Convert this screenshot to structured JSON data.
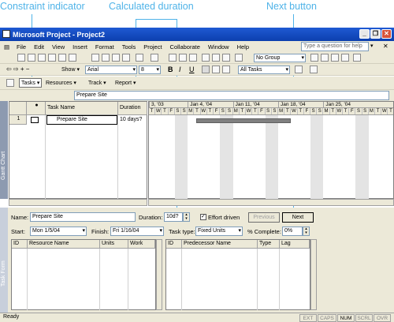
{
  "callouts": {
    "constraint": "Constraint indicator",
    "duration": "Calculated duration",
    "next": "Next button"
  },
  "window": {
    "title": "Microsoft Project - Project2"
  },
  "menu": [
    "File",
    "Edit",
    "View",
    "Insert",
    "Format",
    "Tools",
    "Project",
    "Collaborate",
    "Window",
    "Help"
  ],
  "help_placeholder": "Type a question for help",
  "toolbar": {
    "group_value": "No Group",
    "show_label": "Show ▾",
    "font_value": "Arial",
    "size_value": "8",
    "filter_value": "All Tasks",
    "tasks_label": "Tasks ▾",
    "resources_label": "Resources ▾",
    "track_label": "Track ▾",
    "report_label": "Report ▾",
    "bold": "B",
    "italic": "I",
    "underline": "U"
  },
  "entry_value": "Prepare Site",
  "table": {
    "headers": [
      "",
      "",
      "Task Name",
      "Duration"
    ],
    "row": {
      "id": "1",
      "name": "Prepare Site",
      "duration": "10 days?"
    }
  },
  "gantt": {
    "weeks": [
      "3, '03",
      "Jan 4, '04",
      "Jan 11, '04",
      "Jan 18, '04",
      "Jan 25, '04"
    ],
    "days": [
      "T",
      "W",
      "T",
      "F",
      "S",
      "S",
      "M",
      "T",
      "W",
      "T",
      "F",
      "S",
      "S",
      "M",
      "T",
      "W",
      "T",
      "F",
      "S",
      "S",
      "M",
      "T",
      "W",
      "T",
      "F",
      "S",
      "S",
      "M",
      "T",
      "W",
      "T",
      "F",
      "S",
      "S",
      "M",
      "T",
      "W",
      "T"
    ]
  },
  "side_labels": {
    "top": "Gantt Chart",
    "bottom": "Task Form"
  },
  "form": {
    "name_label": "Name:",
    "name_value": "Prepare Site",
    "duration_label": "Duration:",
    "duration_value": "10d?",
    "effort_label": "Effort driven",
    "previous": "Previous",
    "next": "Next",
    "start_label": "Start:",
    "start_value": "Mon 1/5/04",
    "finish_label": "Finish:",
    "finish_value": "Fri 1/16/04",
    "tasktype_label": "Task type:",
    "tasktype_value": "Fixed Units",
    "complete_label": "% Complete:",
    "complete_value": "0%",
    "left_headers": [
      "ID",
      "Resource Name",
      "Units",
      "Work"
    ],
    "right_headers": [
      "ID",
      "Predecessor Name",
      "Type",
      "Lag"
    ]
  },
  "status": {
    "ready": "Ready",
    "indicators": [
      "EXT",
      "CAPS",
      "NUM",
      "SCRL",
      "OVR"
    ]
  }
}
